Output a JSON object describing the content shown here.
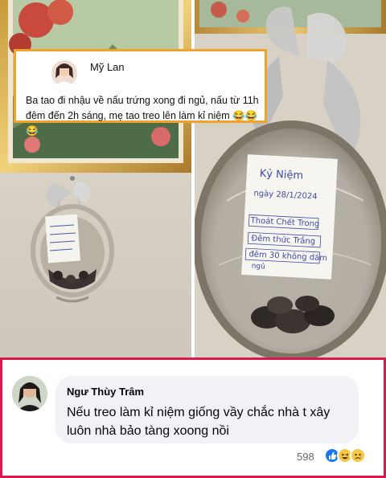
{
  "post": {
    "author": "Mỹ Lan",
    "text": "Ba tao đi nhậu về nấu trứng xong đi ngủ, nấu từ 11h đêm đến 2h sáng, mẹ tao treo lên làm kỉ niệm 😂😂😂"
  },
  "note_right": {
    "line1": "Kỷ Niệm",
    "line2": "ngày 28/1/2024",
    "line3": "Thoát Chết Trong",
    "line4": "Đêm thức Trắng",
    "line5": "đêm 30 không dám",
    "line6": "ngủ"
  },
  "comment": {
    "author": "Ngư Thùy Trâm",
    "text": "Nếu treo làm kỉ niệm giống vầy chắc nhà t xây luôn nhà bảo tàng xoong nồi",
    "reaction_count": "598",
    "reactions": [
      "like",
      "haha",
      "sad"
    ]
  },
  "colors": {
    "post_border": "#f0a32a",
    "comment_border": "#d8184f",
    "like_blue": "#1877f2",
    "reaction_yellow": "#f7c843"
  }
}
